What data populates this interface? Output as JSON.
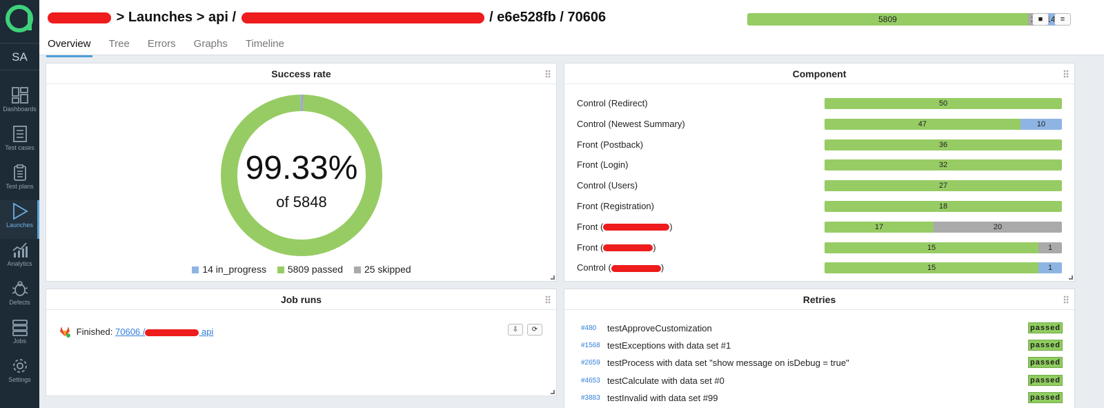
{
  "app": {
    "logo_letter": "a",
    "project_initials": "SA"
  },
  "sidebar": {
    "items": [
      {
        "label": "Dashboards",
        "icon": "dashboard-icon"
      },
      {
        "label": "Test cases",
        "icon": "test-cases-icon"
      },
      {
        "label": "Test plans",
        "icon": "test-plans-icon"
      },
      {
        "label": "Launches",
        "icon": "play-icon",
        "active": true
      },
      {
        "label": "Analytics",
        "icon": "analytics-icon"
      },
      {
        "label": "Defects",
        "icon": "bug-icon"
      },
      {
        "label": "Jobs",
        "icon": "jobs-icon"
      },
      {
        "label": "Settings",
        "icon": "gear-icon"
      }
    ]
  },
  "header": {
    "breadcrumb": {
      "launches": "Launches",
      "sep": ">",
      "api": "api /",
      "commit": "/ e6e528fb / 70606"
    },
    "stats": {
      "passed": 5809,
      "skipped": 25,
      "in_progress": 14,
      "colors": {
        "passed": "#97cc64",
        "skipped": "#aaaaaa",
        "in_progress": "#8eb4e3"
      }
    },
    "buttons": {
      "stop": "■",
      "menu": "≡"
    }
  },
  "tabs": [
    "Overview",
    "Tree",
    "Errors",
    "Graphs",
    "Timeline"
  ],
  "success_rate": {
    "title": "Success rate",
    "percent": "99.33%",
    "of_total": "of 5848",
    "legend": [
      {
        "label": "14 in_progress",
        "color": "#8eb4e3"
      },
      {
        "label": "5809 passed",
        "color": "#97cc64"
      },
      {
        "label": "25 skipped",
        "color": "#aaaaaa"
      }
    ]
  },
  "component": {
    "title": "Component",
    "rows": [
      {
        "label": "Control (Redirect)",
        "segments": [
          {
            "value": 50,
            "status": "passed"
          }
        ]
      },
      {
        "label": "Control (Newest Summary)",
        "segments": [
          {
            "value": 47,
            "status": "passed"
          },
          {
            "value": 10,
            "status": "in_progress"
          }
        ]
      },
      {
        "label": "Front (Postback)",
        "segments": [
          {
            "value": 36,
            "status": "passed"
          }
        ]
      },
      {
        "label": "Front (Login)",
        "segments": [
          {
            "value": 32,
            "status": "passed"
          }
        ]
      },
      {
        "label": "Control (Users)",
        "segments": [
          {
            "value": 27,
            "status": "passed"
          }
        ]
      },
      {
        "label": "Front (Registration)",
        "segments": [
          {
            "value": 18,
            "status": "passed"
          }
        ]
      },
      {
        "label_prefix": "Front (",
        "label_suffix": ")",
        "redacted": true,
        "segments": [
          {
            "value": 17,
            "status": "passed"
          },
          {
            "value": 20,
            "status": "skipped"
          }
        ]
      },
      {
        "label_prefix": "Front (",
        "label_suffix": ")",
        "redacted": true,
        "segments": [
          {
            "value": 15,
            "status": "passed"
          },
          {
            "value": 1,
            "status": "skipped"
          }
        ]
      },
      {
        "label_prefix": "Control (",
        "label_suffix": ")",
        "redacted": true,
        "segments": [
          {
            "value": 15,
            "status": "passed"
          },
          {
            "value": 1,
            "status": "in_progress"
          }
        ]
      }
    ]
  },
  "job_runs": {
    "title": "Job runs",
    "status_prefix": "Finished:",
    "link_start": "70606 /",
    "link_end": "api",
    "buttons": {
      "pin": "⇩",
      "refresh": "⟳"
    }
  },
  "retries": {
    "title": "Retries",
    "rows": [
      {
        "id": "#480",
        "name": "testApproveCustomization",
        "status": "passed"
      },
      {
        "id": "#1568",
        "name": "testExceptions with data set #1",
        "status": "passed"
      },
      {
        "id": "#2659",
        "name": "testProcess with data set \"show message on isDebug = true\"",
        "status": "passed"
      },
      {
        "id": "#4653",
        "name": "testCalculate with data set #0",
        "status": "passed"
      },
      {
        "id": "#3883",
        "name": "testInvalid with data set #99",
        "status": "passed"
      }
    ]
  }
}
